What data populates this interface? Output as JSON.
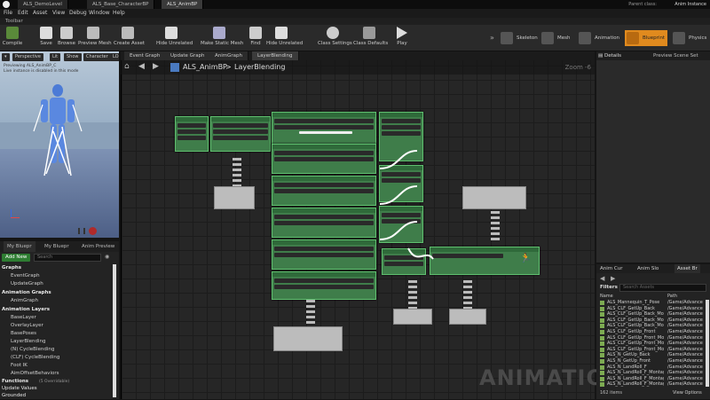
{
  "tabs": [
    "ALS_DemoLevel",
    "ALS_Base_CharacterBP",
    "ALS_AnimBP"
  ],
  "window": {
    "parent_class_label": "Parent class:",
    "parent_class_value": "Anim Instance"
  },
  "menu": [
    "File",
    "Edit",
    "Asset",
    "View",
    "Debug",
    "Window",
    "Help"
  ],
  "toolbar": {
    "header": "Toolbar",
    "buttons": [
      "Compile",
      "Save",
      "Browse",
      "Preview Mesh",
      "Create Asset",
      "Hide Unrelated",
      "Make Static Mesh",
      "Find",
      "Hide Unrelated",
      "Class Settings",
      "Class Defaults",
      "Play"
    ],
    "modes": [
      "Skeleton",
      "Mesh",
      "Animation",
      "Blueprint",
      "Physics"
    ]
  },
  "viewport": {
    "buttons": [
      "Perspective",
      "Lit",
      "Show",
      "Character",
      "LOD"
    ],
    "overlay": [
      "Previewing ALS_AnimBP_C",
      "Live instance is disabled in this mode"
    ]
  },
  "left_tabs": [
    "My Bluepr",
    "My Bluepr",
    "Anim Preview"
  ],
  "left_panel": {
    "add_new": "Add New",
    "search_placeholder": "Search",
    "sections": [
      {
        "title": "Graphs",
        "items": [
          "EventGraph",
          "UpdateGraph"
        ]
      },
      {
        "title": "Animation Graphs",
        "items": [
          "AnimGraph"
        ]
      },
      {
        "title": "Animation Layers",
        "items": [
          "BaseLayer",
          "OverlayLayer",
          "BasePoses",
          "LayerBlending",
          "(N) CycleBlending",
          "(CLF) CycleBlending",
          "Foot IK",
          "AimOffsetBehaviors"
        ]
      },
      {
        "title": "Functions",
        "items": []
      },
      {
        "title": "Update Values",
        "items": []
      },
      {
        "title": "Grounded",
        "items": []
      }
    ],
    "functions_count": "(5 Overridable)"
  },
  "graph": {
    "tabs": [
      "Event Graph",
      "Update Graph",
      "AnimGraph",
      "LayerBlending"
    ],
    "breadcrumb": [
      "ALS_AnimBP",
      "LayerBlending"
    ],
    "zoom": "Zoom -6",
    "watermark": "ANIMATION"
  },
  "details": {
    "tabs": [
      "Details",
      "Preview Scene Set"
    ]
  },
  "assets": {
    "tabs": [
      "Anim Cur",
      "Anim Slo",
      "Asset Br"
    ],
    "filters": "Filters",
    "search_placeholder": "Search Assets",
    "columns": [
      "Name",
      "Path"
    ],
    "rows": [
      {
        "name": "ALS_Mannequin_T_Pose",
        "path": "/Game/Advance"
      },
      {
        "name": "ALS_CLF_GetUp_Back",
        "path": "/Game/Advance"
      },
      {
        "name": "ALS_CLF_GetUp_Back_Mont",
        "path": "/Game/Advance"
      },
      {
        "name": "ALS_CLF_GetUp_Back_Mont",
        "path": "/Game/Advance"
      },
      {
        "name": "ALS_CLF_GetUp_Back_Mont",
        "path": "/Game/Advance"
      },
      {
        "name": "ALS_CLF_GetUp_Front",
        "path": "/Game/Advance"
      },
      {
        "name": "ALS_CLF_GetUp_Front_Mont",
        "path": "/Game/Advance"
      },
      {
        "name": "ALS_CLF_GetUp_Front_Mont",
        "path": "/Game/Advance"
      },
      {
        "name": "ALS_CLF_GetUp_Front_Mont",
        "path": "/Game/Advance"
      },
      {
        "name": "ALS_N_GetUp_Back",
        "path": "/Game/Advance"
      },
      {
        "name": "ALS_N_GetUp_Front",
        "path": "/Game/Advance"
      },
      {
        "name": "ALS_N_LandRoll_F",
        "path": "/Game/Advance"
      },
      {
        "name": "ALS_N_LandRoll_F_Montage",
        "path": "/Game/Advance"
      },
      {
        "name": "ALS_N_LandRoll_F_Montage",
        "path": "/Game/Advance"
      },
      {
        "name": "ALS_N_LandRoll_F_Montage",
        "path": "/Game/Advance"
      }
    ],
    "count": "162 items",
    "view_options": "View Options"
  }
}
